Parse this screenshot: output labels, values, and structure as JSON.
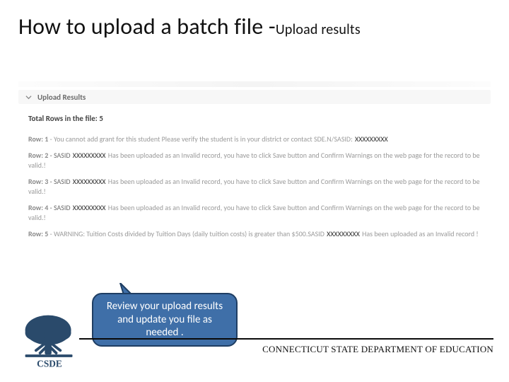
{
  "title": {
    "main": "How to upload a batch file ",
    "dash": "-",
    "sub": "Upload results"
  },
  "panel": {
    "heading": "Upload Results",
    "total_label": "Total Rows in the file:",
    "total_value": "5",
    "mask": "XXXXXXXXX",
    "rows": [
      {
        "num": "Row:  1",
        "text_a": "  -  You cannot add grant for this student Please verify the student is in your district or contact SDE.N/SASID: ",
        "mask_pos": "end"
      },
      {
        "num": "Row:  2",
        "text_a": "  -  SASID ",
        "text_b": " Has been uploaded as an Invalid record, you have to click Save button and Confirm Warnings on the web page for the record to be valid.!",
        "mask_pos": "mid"
      },
      {
        "num": "Row:  3",
        "text_a": "  -  SASID ",
        "text_b": " Has been uploaded as an Invalid record, you have to click Save button and Confirm Warnings on the web page for the record to be valid.!",
        "mask_pos": "mid"
      },
      {
        "num": "Row:  4",
        "text_a": "  -  SASID ",
        "text_b": " Has been uploaded as an Invalid record, you have to click Save button and Confirm Warnings on the web page for the record to be valid.!",
        "mask_pos": "mid"
      },
      {
        "num": "Row:  5",
        "text_a": "  -  WARNING: Tuition Costs divided by Tuition Days (daily tuition costs) is greater than $500.SASID ",
        "text_b": " Has been uploaded as an Invalid record !",
        "mask_pos": "mid"
      }
    ]
  },
  "callout": {
    "text": "Review your  upload results and update you file as needed ."
  },
  "footer": {
    "org": "CONNECTICUT STATE DEPARTMENT OF EDUCATION",
    "logo_label": "CSDE"
  },
  "colors": {
    "callout_bg": "#3f6fa8",
    "callout_border": "#1f3e63",
    "tree": "#2a4a6b"
  }
}
